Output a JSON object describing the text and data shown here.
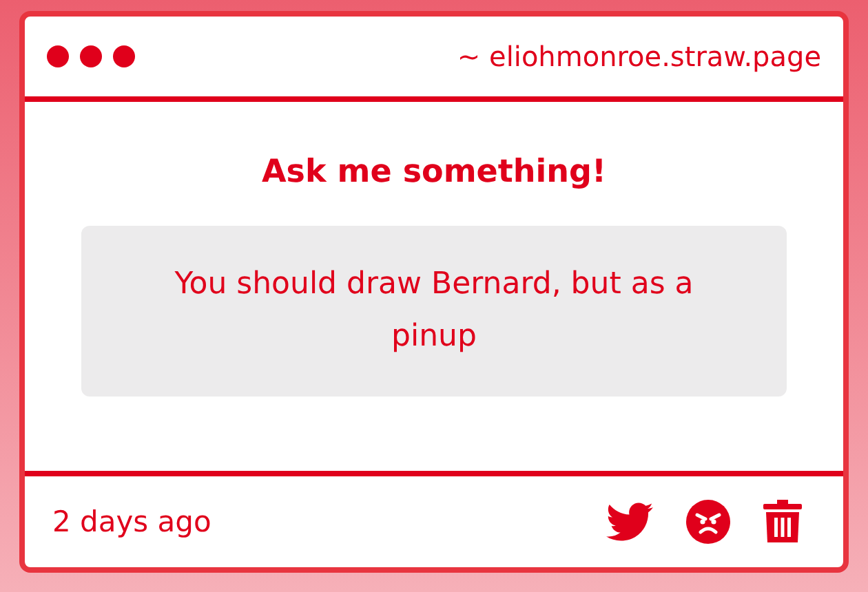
{
  "window": {
    "address": "~ eliohmonroe.straw.page"
  },
  "heading": "Ask me something!",
  "question": "You should draw Bernard, but as a pinup",
  "footer": {
    "time": "2 days ago"
  }
}
